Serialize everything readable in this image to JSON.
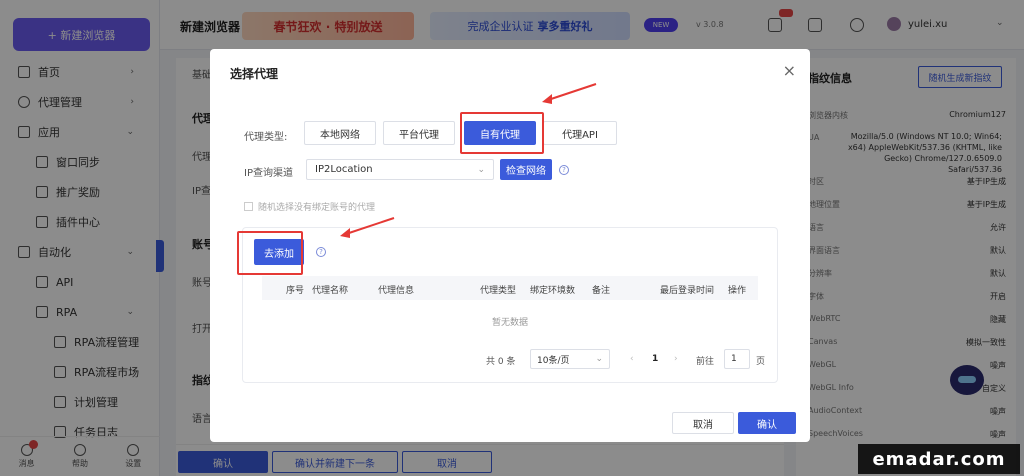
{
  "sidebar": {
    "new_button": "+ 新建浏览器",
    "items": [
      {
        "label": "首页",
        "level": 1
      },
      {
        "label": "代理管理",
        "level": 1
      },
      {
        "label": "应用",
        "level": 1
      },
      {
        "label": "窗口同步",
        "level": 2
      },
      {
        "label": "推广奖励",
        "level": 2
      },
      {
        "label": "插件中心",
        "level": 2
      },
      {
        "label": "自动化",
        "level": 1
      },
      {
        "label": "API",
        "level": 2
      },
      {
        "label": "RPA",
        "level": 2
      },
      {
        "label": "RPA流程管理",
        "level": 3
      },
      {
        "label": "RPA流程市场",
        "level": 3
      },
      {
        "label": "计划管理",
        "level": 3
      },
      {
        "label": "任务日志",
        "level": 3
      }
    ],
    "bottom": {
      "messages": "消息",
      "help": "帮助",
      "settings": "设置"
    }
  },
  "topbar": {
    "title": "新建浏览器",
    "banner1": "春节狂欢 · 特别放送",
    "banner2_prefix": "完成企业认证",
    "banner2_strong": "享多重好礼",
    "new_pill": "NEW",
    "version": "v 3.0.8",
    "user_name": "yulei.xu"
  },
  "background": {
    "basic_label": "基础",
    "proxy_section": "代理",
    "proxy_label": "代理",
    "ip_label": "IP查",
    "account_section": "账号",
    "account_label": "账号",
    "open_label": "打开",
    "fingerprint_section": "指纹",
    "lang_label": "语言",
    "confirm": "确认",
    "confirm_next": "确认并新建下一条",
    "cancel": "取消"
  },
  "right_panel": {
    "title": "指纹信息",
    "button": "随机生成新指纹",
    "rows": [
      {
        "label": "浏览器内核",
        "value": "Chromium127"
      },
      {
        "label": "UA",
        "value": ""
      },
      {
        "label": "时区",
        "value": "基于IP生成"
      },
      {
        "label": "地理位置",
        "value": "基于IP生成"
      },
      {
        "label": "语言",
        "value": "允许"
      },
      {
        "label": "界面语言",
        "value": "默认"
      },
      {
        "label": "分辨率",
        "value": "默认"
      },
      {
        "label": "字体",
        "value": "开启"
      },
      {
        "label": "WebRTC",
        "value": "隐藏"
      },
      {
        "label": "Canvas",
        "value": "模拟一致性"
      },
      {
        "label": "WebGL",
        "value": "噪声"
      },
      {
        "label": "WebGL Info",
        "value": "自定义"
      },
      {
        "label": "AudioContext",
        "value": "噪声"
      },
      {
        "label": "SpeechVoices",
        "value": "噪声"
      }
    ],
    "ua_text": "Mozilla/5.0 (Windows NT 10.0; Win64; x64) AppleWebKit/537.36 (KHTML, like Gecko) Chrome/127.0.6509.0 Safari/537.36"
  },
  "modal": {
    "title": "选择代理",
    "proxy_type_label": "代理类型:",
    "proxy_types": [
      "本地网络",
      "平台代理",
      "自有代理",
      "代理API"
    ],
    "active_type": "自有代理",
    "ip_channel_label": "IP查询渠道",
    "ip_channel_value": "IP2Location",
    "check_button": "检查网络",
    "checkbox_label": "随机选择没有绑定账号的代理",
    "add_button": "去添加",
    "table_columns": [
      "序号",
      "代理名称",
      "代理信息",
      "代理类型",
      "绑定环境数",
      "备注",
      "最后登录时间",
      "操作"
    ],
    "empty_text": "暂无数据",
    "pager": {
      "total": "共 0 条",
      "page_size": "10条/页",
      "current_page": "1",
      "goto_label": "前往",
      "goto_value": "1",
      "page_unit": "页"
    },
    "cancel": "取消",
    "confirm": "确认"
  },
  "watermark": "emadar.com"
}
